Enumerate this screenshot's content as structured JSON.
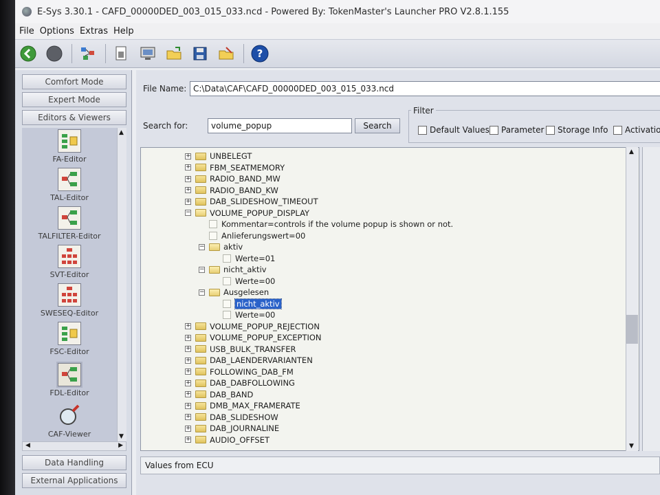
{
  "window": {
    "title": "E-Sys 3.30.1 - CAFD_00000DED_003_015_033.ncd  - Powered By: TokenMaster's Launcher PRO V2.8.1.155"
  },
  "menu": [
    "File",
    "Options",
    "Extras",
    "Help"
  ],
  "toolbar": {
    "icons": [
      "back-icon",
      "stop-icon",
      "network-icon",
      "document-icon",
      "monitor-icon",
      "open-folder-icon",
      "save-icon",
      "folder-edit-icon",
      "help-icon"
    ]
  },
  "modes": {
    "comfort": "Comfort Mode",
    "expert": "Expert Mode",
    "editors": "Editors & Viewers"
  },
  "editors": [
    {
      "label": "FA-Editor"
    },
    {
      "label": "TAL-Editor"
    },
    {
      "label": "TALFILTER-Editor"
    },
    {
      "label": "SVT-Editor"
    },
    {
      "label": "SWESEQ-Editor"
    },
    {
      "label": "FSC-Editor"
    },
    {
      "label": "FDL-Editor"
    },
    {
      "label": "CAF-Viewer"
    }
  ],
  "bottom_buttons": {
    "data_handling": "Data Handling",
    "external_apps": "External Applications"
  },
  "form": {
    "filename_label": "File Name:",
    "filename_value": "C:\\Data\\CAF\\CAFD_00000DED_003_015_033.ncd",
    "search_label": "Search for:",
    "search_value": "volume_popup",
    "search_button": "Search"
  },
  "filter": {
    "title": "Filter",
    "options": [
      "Default Values",
      "Parameter",
      "Storage Info",
      "Activation"
    ]
  },
  "tree": [
    {
      "text": "UNBELEGT",
      "level": 0,
      "type": "folder",
      "exp": "+"
    },
    {
      "text": "FBM_SEATMEMORY",
      "level": 0,
      "type": "folder",
      "exp": "+"
    },
    {
      "text": "RADIO_BAND_MW",
      "level": 0,
      "type": "folder",
      "exp": "+"
    },
    {
      "text": "RADIO_BAND_KW",
      "level": 0,
      "type": "folder",
      "exp": "+"
    },
    {
      "text": "DAB_SLIDESHOW_TIMEOUT",
      "level": 0,
      "type": "folder",
      "exp": "+"
    },
    {
      "text": "VOLUME_POPUP_DISPLAY",
      "level": 0,
      "type": "folder-open",
      "exp": "-"
    },
    {
      "text": "Kommentar=controls if the volume popup is shown or not.",
      "level": 1,
      "type": "leaf"
    },
    {
      "text": "Anlieferungswert=00",
      "level": 1,
      "type": "leaf"
    },
    {
      "text": "aktiv",
      "level": 1,
      "type": "folder-open",
      "exp": "-"
    },
    {
      "text": "Werte=01",
      "level": 2,
      "type": "leaf"
    },
    {
      "text": "nicht_aktiv",
      "level": 1,
      "type": "folder-open",
      "exp": "-"
    },
    {
      "text": "Werte=00",
      "level": 2,
      "type": "leaf"
    },
    {
      "text": "Ausgelesen",
      "level": 1,
      "type": "folder-open",
      "exp": "-"
    },
    {
      "text": "nicht_aktiv",
      "level": 2,
      "type": "leaf",
      "selected": true
    },
    {
      "text": "Werte=00",
      "level": 2,
      "type": "leaf"
    },
    {
      "text": "VOLUME_POPUP_REJECTION",
      "level": 0,
      "type": "folder",
      "exp": "+"
    },
    {
      "text": "VOLUME_POPUP_EXCEPTION",
      "level": 0,
      "type": "folder",
      "exp": "+"
    },
    {
      "text": "USB_BULK_TRANSFER",
      "level": 0,
      "type": "folder",
      "exp": "+"
    },
    {
      "text": "DAB_LAENDERVARIANTEN",
      "level": 0,
      "type": "folder",
      "exp": "+"
    },
    {
      "text": "FOLLOWING_DAB_FM",
      "level": 0,
      "type": "folder",
      "exp": "+"
    },
    {
      "text": "DAB_DABFOLLOWING",
      "level": 0,
      "type": "folder",
      "exp": "+"
    },
    {
      "text": "DAB_BAND",
      "level": 0,
      "type": "folder",
      "exp": "+"
    },
    {
      "text": "DMB_MAX_FRAMERATE",
      "level": 0,
      "type": "folder",
      "exp": "+"
    },
    {
      "text": "DAB_SLIDESHOW",
      "level": 0,
      "type": "folder",
      "exp": "+"
    },
    {
      "text": "DAB_JOURNALINE",
      "level": 0,
      "type": "folder",
      "exp": "+"
    },
    {
      "text": "AUDIO_OFFSET",
      "level": 0,
      "type": "folder",
      "exp": "+"
    }
  ],
  "values_bar": "Values from ECU"
}
